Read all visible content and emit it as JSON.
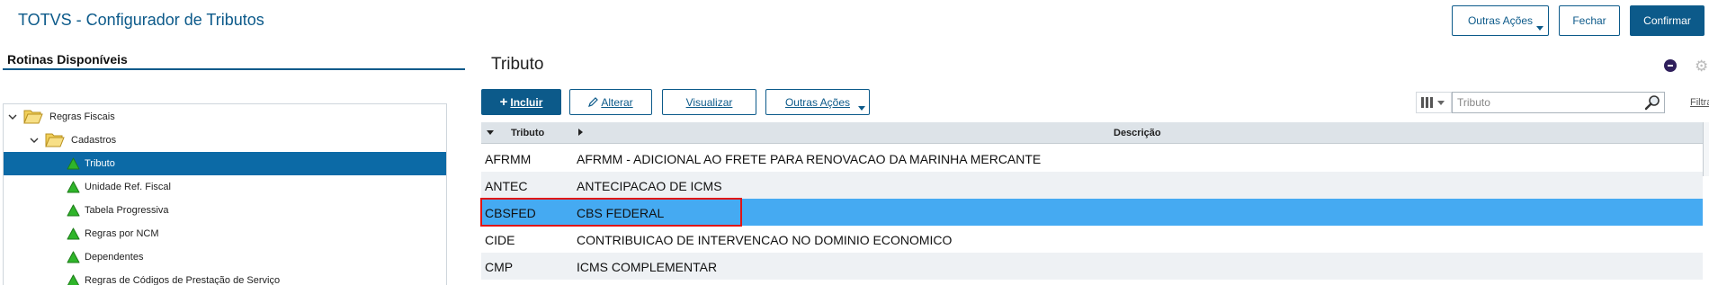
{
  "app": {
    "title": "TOTVS - Configurador de Tributos"
  },
  "header_actions": {
    "outras_acoes": "Outras Ações",
    "fechar": "Fechar",
    "confirmar": "Confirmar"
  },
  "left_panel": {
    "title": "Rotinas Disponíveis",
    "tree": [
      {
        "label": "Regras Fiscais",
        "icon": "folder-open-icon",
        "level": 0,
        "expanded": true
      },
      {
        "label": "Cadastros",
        "icon": "folder-open-icon",
        "level": 1,
        "expanded": true
      },
      {
        "label": "Tributo",
        "icon": "green-triangle-icon",
        "level": 2,
        "selected": true
      },
      {
        "label": "Unidade Ref. Fiscal",
        "icon": "green-triangle-icon",
        "level": 2
      },
      {
        "label": "Tabela Progressiva",
        "icon": "green-triangle-icon",
        "level": 2
      },
      {
        "label": "Regras por NCM",
        "icon": "green-triangle-icon",
        "level": 2
      },
      {
        "label": "Dependentes",
        "icon": "green-triangle-icon",
        "level": 2
      },
      {
        "label": "Regras de Códigos de Prestação de Serviço",
        "icon": "green-triangle-icon",
        "level": 2
      }
    ]
  },
  "main": {
    "title": "Tributo",
    "toolbar": {
      "incluir_icon": "+",
      "incluir": "Incluir",
      "alterar": "Alterar",
      "visualizar": "Visualizar",
      "outras_acoes": "Outras Ações"
    },
    "search": {
      "placeholder": "Tributo",
      "value": ""
    },
    "filter_label": "Filtra",
    "grid": {
      "columns": {
        "code": "Tributo",
        "description": "Descrição"
      },
      "rows": [
        {
          "code": "AFRMM",
          "description": "AFRMM - ADICIONAL AO FRETE PARA RENOVACAO DA MARINHA MERCANTE"
        },
        {
          "code": "ANTEC",
          "description": "ANTECIPACAO DE ICMS"
        },
        {
          "code": "CBSFED",
          "description": "CBS FEDERAL",
          "selected": true
        },
        {
          "code": "CIDE",
          "description": "CONTRIBUICAO DE INTERVENCAO NO DOMINIO ECONOMICO"
        },
        {
          "code": "CMP",
          "description": "ICMS COMPLEMENTAR"
        }
      ]
    }
  },
  "colors": {
    "brand": "#0c5a8a",
    "selected_row": "#45aaf2",
    "tree_selected": "#0c6aa6",
    "highlight_box": "#e01616"
  }
}
